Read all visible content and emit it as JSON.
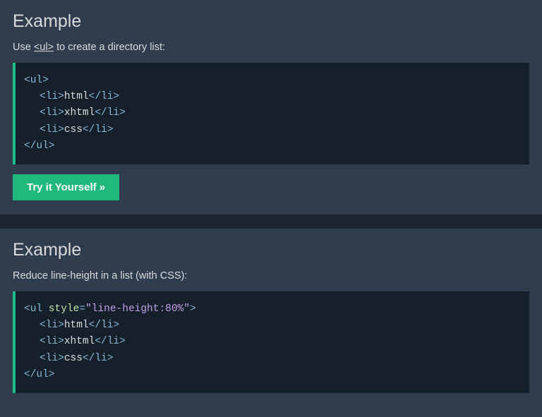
{
  "example1": {
    "heading": "Example",
    "desc_pre": "Use ",
    "desc_tag": "<ul>",
    "desc_post": " to create a directory list:",
    "code": {
      "ul_open": "<ul>",
      "li_open": "<li>",
      "li_close": "</li>",
      "item1": "html",
      "item2": "xhtml",
      "item3": "css",
      "ul_close": "</ul>"
    },
    "button": "Try it Yourself »"
  },
  "example2": {
    "heading": "Example",
    "desc": "Reduce line-height in a list (with CSS):",
    "code": {
      "ul_open_pre": "<ul",
      "attr_name": " style",
      "eq": "=",
      "attr_val": "\"line-height:80%\"",
      "ul_open_post": ">",
      "li_open": "<li>",
      "li_close": "</li>",
      "item1": "html",
      "item2": "xhtml",
      "item3": "css",
      "ul_close": "</ul>"
    }
  }
}
